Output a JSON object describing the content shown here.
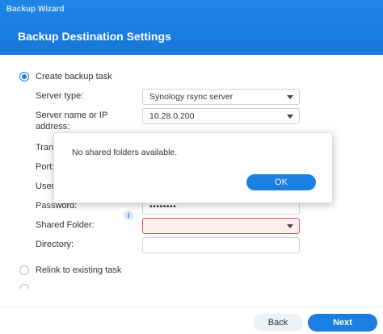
{
  "window": {
    "title": "Backup Wizard"
  },
  "page": {
    "title": "Backup Destination Settings"
  },
  "options": {
    "create": "Create backup task",
    "relink": "Relink to existing task"
  },
  "fields": {
    "server_type": {
      "label": "Server type:",
      "value": "Synology rsync server"
    },
    "server_name": {
      "label_line1": "Server name or IP",
      "label_line2": "address:",
      "value": "10.28.0.200"
    },
    "transfer": {
      "label": "Trans"
    },
    "port": {
      "label": "Port:"
    },
    "username": {
      "label": "Usern"
    },
    "password": {
      "label": "Password:",
      "value": "••••••••"
    },
    "shared_folder": {
      "label": "Shared Folder:",
      "value": ""
    },
    "directory": {
      "label": "Directory:",
      "value": ""
    }
  },
  "icons": {
    "info": "i"
  },
  "dialog": {
    "message": "No shared folders available.",
    "ok_label": "OK"
  },
  "footer": {
    "back_label": "Back",
    "next_label": "Next"
  },
  "colors": {
    "accent": "#1a7fe0",
    "error_border": "#e0595a"
  }
}
